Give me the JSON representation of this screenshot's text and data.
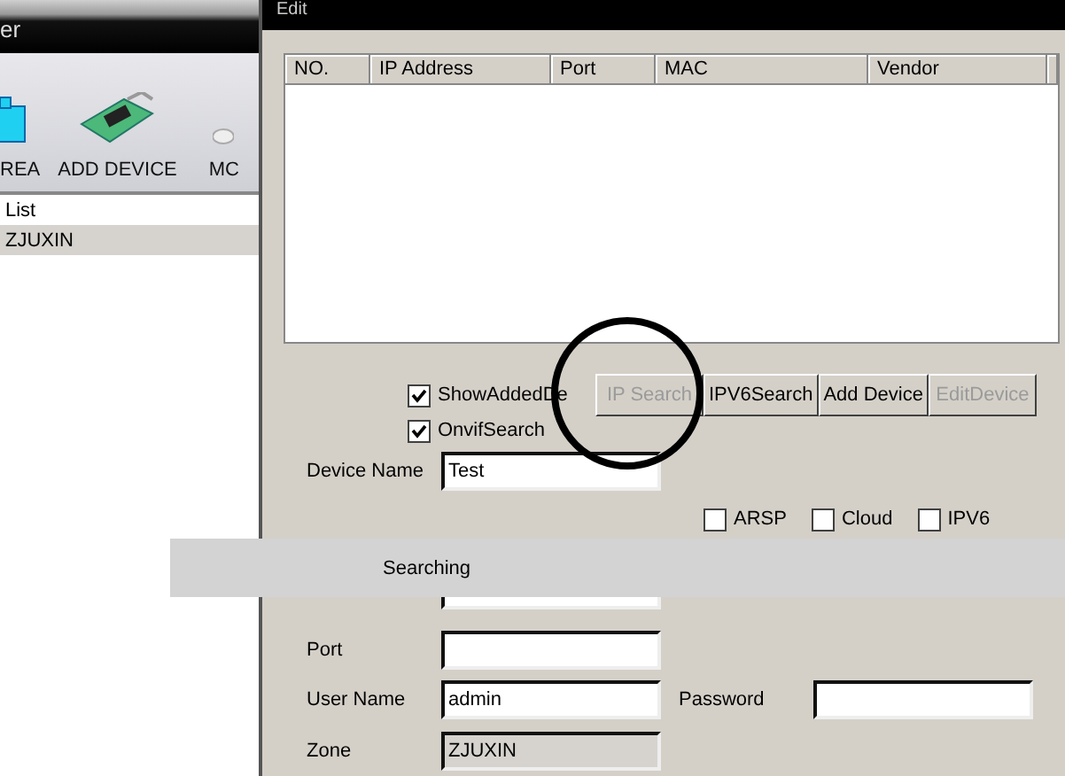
{
  "background_window": {
    "title": "er",
    "toolbar": [
      {
        "label": "REA",
        "kind": "folder"
      },
      {
        "label": "ADD DEVICE",
        "kind": "card"
      },
      {
        "label": "MC",
        "kind": "partial"
      }
    ],
    "list": [
      {
        "label": "List",
        "selected": false
      },
      {
        "label": "ZJUXIN",
        "selected": true
      }
    ]
  },
  "dialog": {
    "title": "Edit",
    "table": {
      "columns": [
        "NO.",
        "IP Address",
        "Port",
        "MAC",
        "Vendor"
      ]
    },
    "show_added_device": {
      "label": "ShowAddedDe",
      "checked": true
    },
    "buttons": [
      {
        "label": "IP Search",
        "disabled": true
      },
      {
        "label": "IPV6Search",
        "disabled": false
      },
      {
        "label": "Add Device",
        "disabled": false
      },
      {
        "label": "EditDevice",
        "disabled": true
      }
    ],
    "onvif_search": {
      "label": "OnvifSearch",
      "checked": true
    },
    "device_name": {
      "label": "Device Name",
      "value": "Test"
    },
    "login_types": [
      {
        "label": "ARSP",
        "checked": false
      },
      {
        "label": "Cloud",
        "checked": false
      },
      {
        "label": "IPV6",
        "checked": false
      }
    ],
    "port": {
      "label": "Port"
    },
    "user_name": {
      "label": "User Name",
      "value": "admin"
    },
    "password": {
      "label": "Password"
    },
    "zone": {
      "label": "Zone",
      "value": "ZJUXIN",
      "disabled": true
    }
  },
  "progress_overlay": {
    "text": "Searching"
  }
}
